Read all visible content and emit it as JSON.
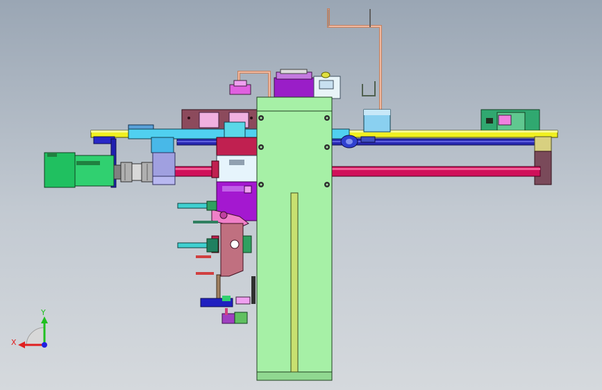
{
  "triad": {
    "x_label": "X",
    "y_label": "Y",
    "x_color": "#e02020",
    "y_color": "#20c020",
    "z_color": "#2020e0"
  },
  "colors": {
    "background_top": "#9aa6b4",
    "background_bottom": "#d5d9dd",
    "column": "#a6f0a6",
    "rail": "#f0f020",
    "rod": "#d0105a",
    "motor": "#20c060",
    "carriage": "#a020d0"
  }
}
